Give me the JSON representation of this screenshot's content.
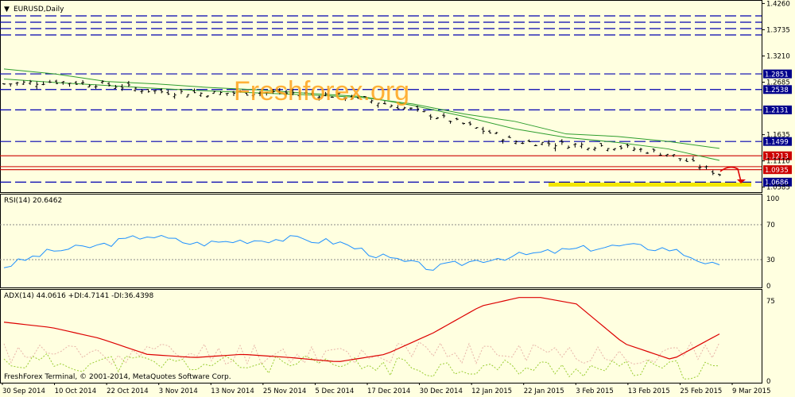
{
  "window": {
    "symbol_title": "EURUSD,Daily",
    "menu_glyph": "▼"
  },
  "watermark": "Freshforex.org",
  "footer": "FreshForex Terminal, © 2001-2014, MetaQuotes Software Corp.",
  "price_axis": {
    "labels": [
      "1.4260",
      "1.3735",
      "1.3210",
      "1.2685",
      "1.1635",
      "1.1110",
      "1.0585"
    ],
    "range": [
      1.0585,
      1.426
    ]
  },
  "price_tags": [
    {
      "value": "1.2851",
      "color": "#00008b"
    },
    {
      "value": "1.2538",
      "color": "#00008b"
    },
    {
      "value": "1.2131",
      "color": "#00008b"
    },
    {
      "value": "1.1499",
      "color": "#00008b"
    },
    {
      "value": "1.1213",
      "color": "#cc0000"
    },
    {
      "value": "1.0935",
      "color": "#cc0000"
    },
    {
      "value": "1.0686",
      "color": "#00008b"
    }
  ],
  "rsi": {
    "label": "RSI(14) 20.6462",
    "axis_labels": [
      "100",
      "70",
      "30",
      "0"
    ],
    "levels": [
      70,
      30
    ]
  },
  "adx": {
    "label": "ADX(14) 44.0616 +DI:4.7141 -DI:36.4398",
    "axis_labels": [
      "75",
      "0"
    ]
  },
  "time_axis": [
    "30 Sep 2014",
    "10 Oct 2014",
    "22 Oct 2014",
    "3 Nov 2014",
    "13 Nov 2014",
    "25 Nov 2014",
    "5 Dec 2014",
    "17 Dec 2014",
    "30 Dec 2014",
    "12 Jan 2015",
    "22 Jan 2015",
    "3 Feb 2015",
    "13 Feb 2015",
    "25 Feb 2015",
    "9 Mar 2015"
  ],
  "colors": {
    "background": "#ffffe0",
    "grid": "#0000b0",
    "bars": "#000000",
    "ma": "#2e9e2e",
    "rsi_line": "#1e90ff",
    "adx_line": "#dd0000",
    "plus_di": "#9acd32",
    "minus_di": "#e8b4a8",
    "support": "#f2e600",
    "forecast_arrow": "#dd0000",
    "resistance": "#cc0000",
    "watermark": "#ffa31a"
  },
  "chart_data": {
    "type": "line",
    "title": "EURUSD,Daily",
    "x": [
      "30 Sep 2014",
      "10 Oct 2014",
      "22 Oct 2014",
      "3 Nov 2014",
      "13 Nov 2014",
      "25 Nov 2014",
      "5 Dec 2014",
      "17 Dec 2014",
      "30 Dec 2014",
      "12 Jan 2015",
      "22 Jan 2015",
      "3 Feb 2015",
      "13 Feb 2015",
      "25 Feb 2015",
      "9 Mar 2015"
    ],
    "series": [
      {
        "values": [
          1.265,
          1.27,
          1.264,
          1.25,
          1.246,
          1.248,
          1.246,
          1.236,
          1.213,
          1.185,
          1.15,
          1.144,
          1.14,
          1.125,
          1.085
        ]
      },
      {
        "values": [
          1.295,
          1.285,
          1.27,
          1.265,
          1.258,
          1.253,
          1.246,
          1.24,
          1.222,
          1.2,
          1.175,
          1.158,
          1.148,
          1.135,
          1.112
        ]
      },
      {
        "values": [
          1.275,
          1.268,
          1.262,
          1.256,
          1.251,
          1.247,
          1.243,
          1.238,
          1.225,
          1.205,
          1.19,
          1.165,
          1.16,
          1.15,
          1.136
        ]
      }
    ],
    "horizontal_levels": [
      1.2851,
      1.2538,
      1.2131,
      1.1499,
      1.1213,
      1.0935,
      1.0686
    ],
    "ylim": [
      1.0585,
      1.426
    ],
    "rsi_values": [
      22,
      40,
      46,
      58,
      48,
      52,
      54,
      50,
      32,
      20,
      30,
      36,
      42,
      46,
      42,
      21
    ],
    "adx_values": [
      55,
      50,
      40,
      25,
      22,
      25,
      22,
      18,
      25,
      45,
      70,
      80,
      72,
      35,
      20,
      44
    ],
    "grid": true
  }
}
